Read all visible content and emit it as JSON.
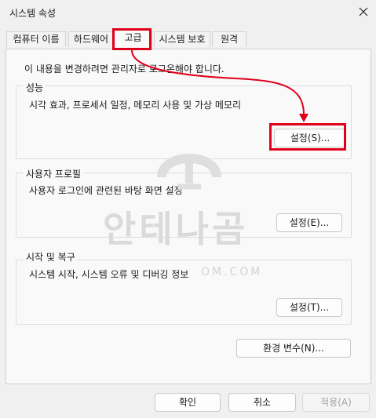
{
  "window": {
    "title": "시스템 속성",
    "close_icon": "close-icon"
  },
  "tabs": [
    {
      "label": "컴퓨터 이름",
      "active": false
    },
    {
      "label": "하드웨어",
      "active": false
    },
    {
      "label": "고급",
      "active": true
    },
    {
      "label": "시스템 보호",
      "active": false
    },
    {
      "label": "원격",
      "active": false
    }
  ],
  "notice": "이 내용을 변경하려면 관리자로 로그온해야 합니다.",
  "groups": {
    "performance": {
      "title": "성능",
      "description": "시각 효과, 프로세서 일정, 메모리 사용 및 가상 메모리",
      "button": "설정(S)..."
    },
    "user_profiles": {
      "title": "사용자 프로필",
      "description": "사용자 로그인에 관련된 바탕 화면 설정",
      "button": "설정(E)..."
    },
    "startup_recovery": {
      "title": "시작 및 복구",
      "description": "시스템 시작, 시스템 오류 및 디버깅 정보",
      "button": "설정(T)..."
    }
  },
  "env_button": "환경 변수(N)...",
  "footer": {
    "ok": "확인",
    "cancel": "취소",
    "apply": "적용(A)"
  },
  "watermark": {
    "text": "안테나곰",
    "subtext": "OM.COM"
  },
  "colors": {
    "highlight": "#e0001b",
    "background": "#f0f0f0",
    "page": "#f9f9f9"
  }
}
